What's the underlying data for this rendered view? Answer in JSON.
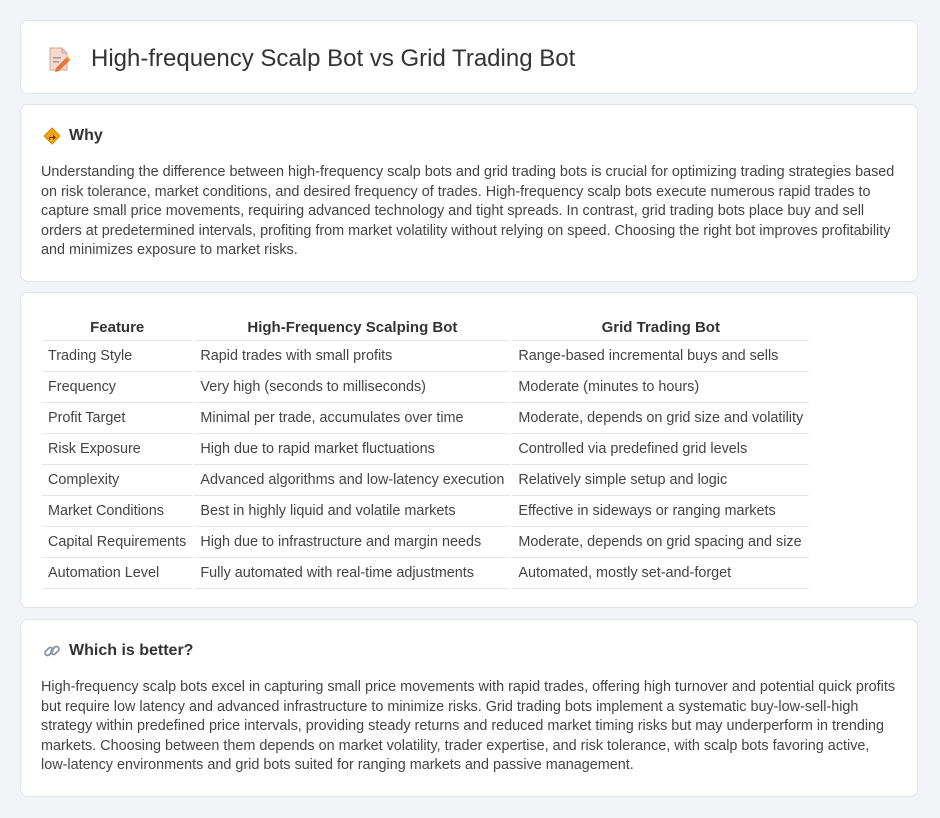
{
  "page": {
    "title": "High-frequency Scalp Bot vs Grid Trading Bot",
    "title_icon": "document-edit-icon"
  },
  "why": {
    "heading": "Why",
    "icon": "diamond-sign-icon",
    "body": "Understanding the difference between high-frequency scalp bots and grid trading bots is crucial for optimizing trading strategies based on risk tolerance, market conditions, and desired frequency of trades. High-frequency scalp bots execute numerous rapid trades to capture small price movements, requiring advanced technology and tight spreads. In contrast, grid trading bots place buy and sell orders at predetermined intervals, profiting from market volatility without relying on speed. Choosing the right bot improves profitability and minimizes exposure to market risks."
  },
  "table": {
    "headers": [
      "Feature",
      "High-Frequency Scalping Bot",
      "Grid Trading Bot"
    ],
    "rows": [
      [
        "Trading Style",
        "Rapid trades with small profits",
        "Range-based incremental buys and sells"
      ],
      [
        "Frequency",
        "Very high (seconds to milliseconds)",
        "Moderate (minutes to hours)"
      ],
      [
        "Profit Target",
        "Minimal per trade, accumulates over time",
        "Moderate, depends on grid size and volatility"
      ],
      [
        "Risk Exposure",
        "High due to rapid market fluctuations",
        "Controlled via predefined grid levels"
      ],
      [
        "Complexity",
        "Advanced algorithms and low-latency execution",
        "Relatively simple setup and logic"
      ],
      [
        "Market Conditions",
        "Best in highly liquid and volatile markets",
        "Effective in sideways or ranging markets"
      ],
      [
        "Capital Requirements",
        "High due to infrastructure and margin needs",
        "Moderate, depends on grid spacing and size"
      ],
      [
        "Automation Level",
        "Fully automated with real-time adjustments",
        "Automated, mostly set-and-forget"
      ]
    ]
  },
  "better": {
    "heading": "Which is better?",
    "icon": "link-icon",
    "body": "High-frequency scalp bots excel in capturing small price movements with rapid trades, offering high turnover and potential quick profits but require low latency and advanced infrastructure to minimize risks. Grid trading bots implement a systematic buy-low-sell-high strategy within predefined price intervals, providing steady returns and reduced market timing risks but may underperform in trending markets. Choosing between them depends on market volatility, trader expertise, and risk tolerance, with scalp bots favoring active, low-latency environments and grid bots suited for ranging markets and passive management."
  }
}
